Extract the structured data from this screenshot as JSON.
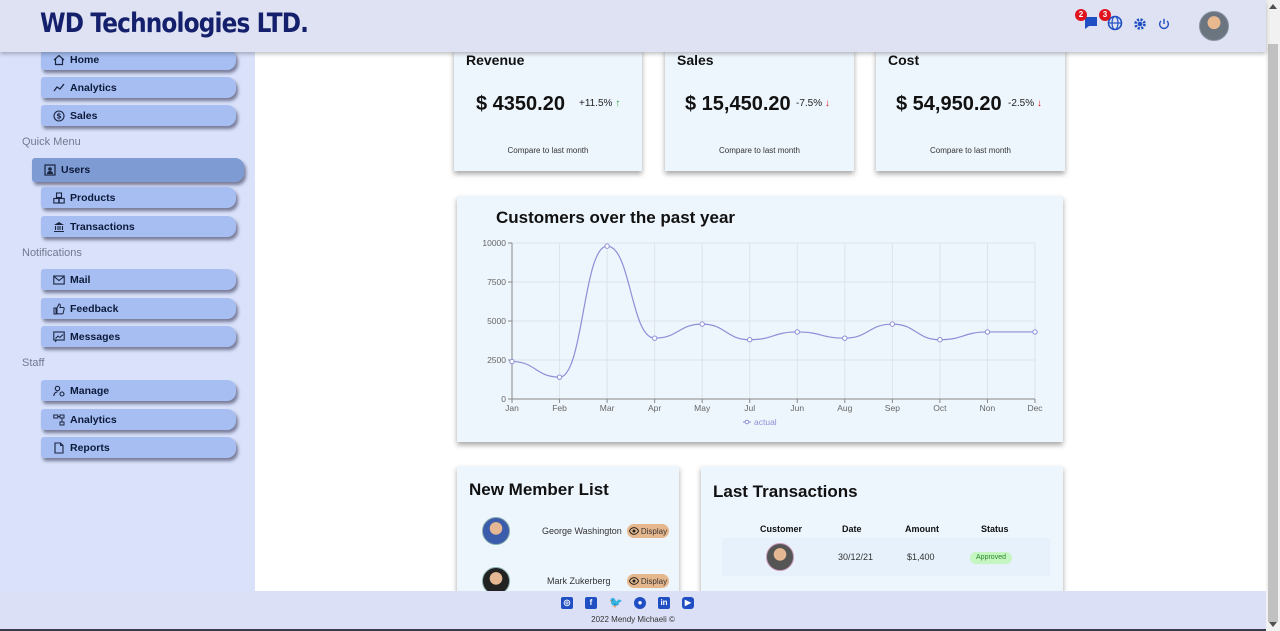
{
  "header": {
    "brand": "WD Technologies LTD.",
    "icons": [
      {
        "name": "messages-icon",
        "badge": "2"
      },
      {
        "name": "language-icon",
        "badge": "3"
      },
      {
        "name": "settings-icon",
        "badge": ""
      },
      {
        "name": "power-icon",
        "badge": ""
      }
    ]
  },
  "sidebar": {
    "dashboard_items": [
      "Home",
      "Analytics",
      "Sales"
    ],
    "quick_menu_title": "Quick Menu",
    "quick_menu_items": [
      "Users",
      "Products",
      "Transactions"
    ],
    "notifications_title": "Notifications",
    "notifications_items": [
      "Mail",
      "Feedback",
      "Messages"
    ],
    "staff_title": "Staff",
    "staff_items": [
      "Manage",
      "Analytics",
      "Reports"
    ],
    "active_item": "Users"
  },
  "kpis": [
    {
      "title": "Revenue",
      "value": "$ 4350.20",
      "rate": "+11.5%",
      "direction": "up",
      "sub": "Compare to last month"
    },
    {
      "title": "Sales",
      "value": "$ 15,450.20",
      "rate": "-7.5%",
      "direction": "down",
      "sub": "Compare to last month"
    },
    {
      "title": "Cost",
      "value": "$ 54,950.20",
      "rate": "-2.5%",
      "direction": "down",
      "sub": "Compare to last month"
    }
  ],
  "chart_data": {
    "type": "line",
    "title": "Customers over the past year",
    "x": [
      "Jan",
      "Feb",
      "Mar",
      "Apr",
      "May",
      "Jul",
      "Jun",
      "Aug",
      "Sep",
      "Oct",
      "Non",
      "Dec"
    ],
    "series": [
      {
        "name": "actual",
        "values": [
          2400,
          1400,
          9800,
          3900,
          4800,
          3800,
          4300,
          3900,
          4800,
          3800,
          4300,
          4300
        ],
        "color": "#8c8fd6"
      }
    ],
    "ylim": [
      0,
      10000
    ],
    "yticks": [
      "0",
      "2500",
      "5000",
      "7500",
      "10000"
    ],
    "grid": true,
    "legend": "bottom-center"
  },
  "members": {
    "title": "New Member List",
    "items": [
      {
        "name": "George Washington",
        "action": "Display"
      },
      {
        "name": "Mark Zukerberg",
        "action": "Display"
      }
    ]
  },
  "transactions": {
    "title": "Last Transactions",
    "columns": [
      "Customer",
      "Date",
      "Amount",
      "Status"
    ],
    "rows": [
      {
        "date": "30/12/21",
        "amount": "$1,400",
        "status": "Approved"
      }
    ]
  },
  "footer": {
    "social": [
      "instagram-icon",
      "facebook-icon",
      "twitter-icon",
      "github-icon",
      "linkedin-icon",
      "youtube-icon"
    ],
    "copyright": "2022 Mendy Michaeli ©"
  },
  "colors": {
    "brand": "#14206b",
    "sidebar_bg": "#d9e1fb",
    "sidebar_button": "#a7bef2",
    "sidebar_active": "#7f9bd3",
    "card_bg": "#eef6fd",
    "up": "#1fa12d",
    "down": "#e21d1d",
    "icon_blue": "#1f4fc2"
  }
}
